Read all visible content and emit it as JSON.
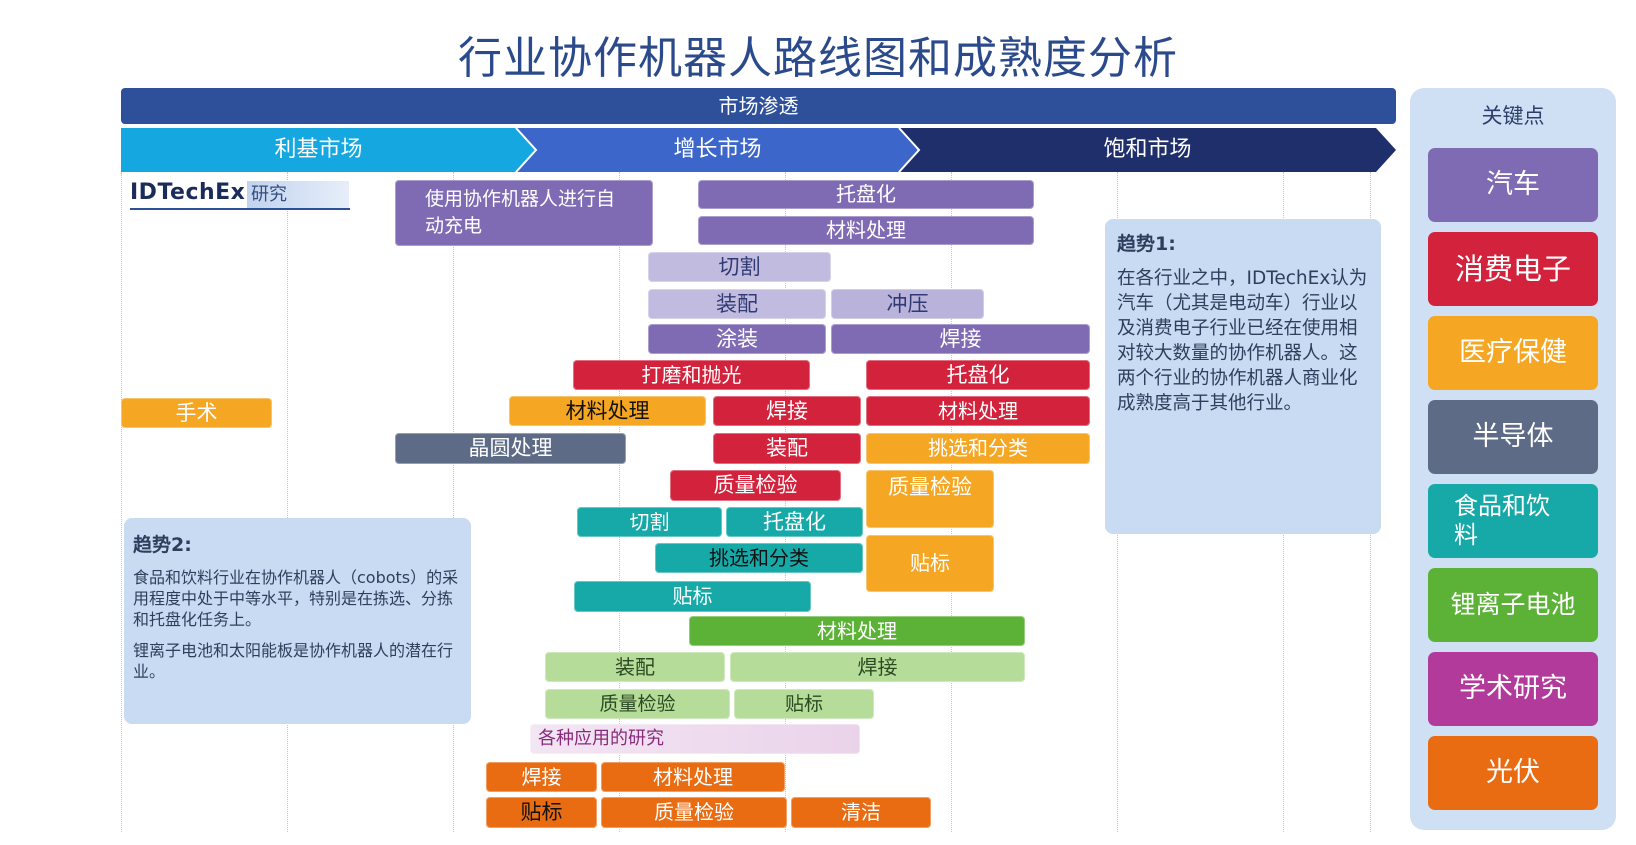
{
  "title": "行业协作机器人路线图和成熟度分析",
  "market_penetration": "市场渗透",
  "phases": [
    "利基市场",
    "增长市场",
    "饱和市场"
  ],
  "brand": {
    "name": "IDTechEx",
    "suffix": "研究"
  },
  "key_points": {
    "title": "关键点",
    "items": [
      {
        "label": "汽车",
        "color": "#7f6bb4"
      },
      {
        "label": "消费电子",
        "color": "#d2223c"
      },
      {
        "label": "医疗保健",
        "color": "#f5a623"
      },
      {
        "label": "半导体",
        "color": "#5e6b86"
      },
      {
        "label": "食品和饮料",
        "color": "#17a8a8"
      },
      {
        "label": "锂离子电池",
        "color": "#5cb237"
      },
      {
        "label": "学术研究",
        "color": "#b23a9b"
      },
      {
        "label": "光伏",
        "color": "#e96b12"
      }
    ]
  },
  "trend1": {
    "heading": "趋势1:",
    "body": "在各行业之中，IDTechEx认为汽车（尤其是电动车）行业以及消费电子行业已经在使用相对较大数量的协作机器人。这两个行业的协作机器人商业化成熟度高于其他行业。"
  },
  "trend2": {
    "heading": "趋势2:",
    "body1": "食品和饮料行业在协作机器人（cobots）的采用程度中处于中等水平，特别是在拣选、分拣和托盘化任务上。",
    "body2": "锂离子电池和太阳能板是协作机器人的潜在行业。"
  },
  "bars": {
    "auto_charging": "使用协作机器人进行自动充电",
    "auto_palletizing": "托盘化",
    "auto_material": "材料处理",
    "auto_cutting": "切割",
    "auto_assembly": "装配",
    "auto_stamping": "冲压",
    "auto_painting": "涂装",
    "auto_welding": "焊接",
    "ce_grinding": "打磨和抛光",
    "ce_palletizing": "托盘化",
    "ce_welding": "焊接",
    "ce_material": "材料处理",
    "ce_assembly": "装配",
    "ce_qc": "质量检验",
    "hc_surgery": "手术",
    "hc_material": "材料处理",
    "hc_pick": "挑选和分类",
    "hc_qc": "质量检验",
    "hc_label": "贴标",
    "semi_wafer": "晶圆处理",
    "fb_cutting": "切割",
    "fb_palletizing": "托盘化",
    "fb_pick": "挑选和分类",
    "fb_label": "贴标",
    "li_material": "材料处理",
    "li_assembly": "装配",
    "li_welding": "焊接",
    "li_qc": "质量检验",
    "li_label": "贴标",
    "ac_research": "各种应用的研究",
    "pv_welding": "焊接",
    "pv_material": "材料处理",
    "pv_label": "贴标",
    "pv_qc": "质量检验",
    "pv_cleaning": "清洁"
  }
}
